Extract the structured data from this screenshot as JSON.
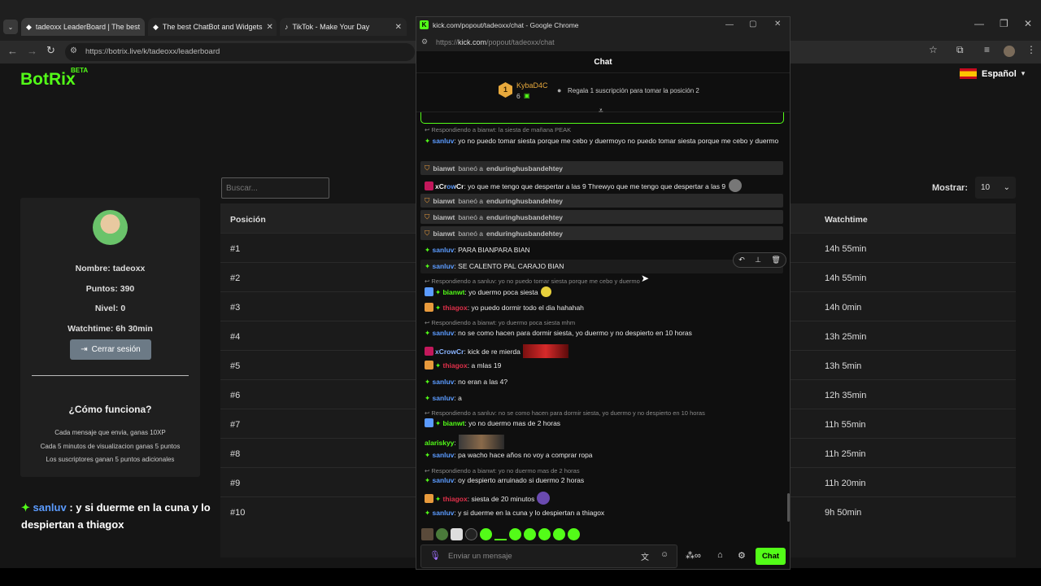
{
  "browser": {
    "tabs": [
      {
        "title": "tadeoxx LeaderBoard | The best"
      },
      {
        "title": "The best ChatBot and Widgets"
      },
      {
        "title": "TikTok - Make Your Day"
      }
    ],
    "url": "https://botrix.live/k/tadeoxx/leaderboard"
  },
  "page": {
    "logo": "BotRix",
    "logo_badge": "BETA",
    "language": "Español",
    "profile": {
      "nombre": "Nombre: tadeoxx",
      "puntos": "Puntos: 390",
      "nivel": "Nivel: 0",
      "watchtime": "Watchtime: 6h 30min",
      "logout": "Cerrar sesión"
    },
    "how": {
      "title": "¿Cómo funciona?",
      "lines": [
        "Cada mensaje que envia, ganas 10XP",
        "Cada 5 minutos de visualizacion ganas 5 puntos",
        "Los suscriptores ganan 5 puntos adicionales"
      ]
    },
    "chat_overlay": {
      "user": "sanluv",
      "text": " : y si duerme en la cuna y lo despiertan a thiagox"
    },
    "search_placeholder": "Buscar...",
    "show_label": "Mostrar:",
    "show_value": "10",
    "table": {
      "col_position": "Posición",
      "col_watchtime": "Watchtime",
      "rows": [
        {
          "pos": "#1",
          "wt": "14h 55min"
        },
        {
          "pos": "#2",
          "wt": "14h 55min"
        },
        {
          "pos": "#3",
          "wt": "14h 0min"
        },
        {
          "pos": "#4",
          "wt": "13h 25min"
        },
        {
          "pos": "#5",
          "wt": "13h 5min"
        },
        {
          "pos": "#6",
          "wt": "12h 35min"
        },
        {
          "pos": "#7",
          "wt": "11h 55min"
        },
        {
          "pos": "#8",
          "wt": "11h 25min"
        },
        {
          "pos": "#9",
          "wt": "11h 20min"
        },
        {
          "pos": "#10",
          "wt": "9h 50min"
        }
      ]
    }
  },
  "popup": {
    "window_title": "kick.com/popout/tadeoxx/chat - Google Chrome",
    "url_prefix": "https://",
    "url_domain": "kick.com",
    "url_path": "/popout/tadeoxx/chat",
    "header": "Chat",
    "pinned": {
      "rank": "1",
      "user": "KybaD4C",
      "count": "6",
      "gift": "Regala 1 suscripción para tomar la posición 2"
    },
    "messages": {
      "r1": "Respondiendo a bianwt: la siesta de mañana PEAK",
      "m1_user": "sanluv",
      "m1_text": ": yo no puedo tomar siesta porque me cebo y duermoyo no puedo tomar siesta porque me cebo y duermo",
      "b1_user": "bianwt",
      "b_mid": "baneó a",
      "b1_target": "enduringhusbandehtey",
      "m2_user": "xCrowCr",
      "m2_text": ": yo que me tengo que despertar a las 9 Threwyo que me tengo que despertar a las 9",
      "m3_user": "sanluv",
      "m3_text": ": PARA BIANPARA BIAN",
      "m4_user": "sanluv",
      "m4_text": ": SE CALENTO PAL CARAJO BIAN",
      "r2": "Respondiendo a sanluv: yo no puedo tomar siesta porque me cebo y duermo",
      "m5_user": "bianwt",
      "m5_text": ": yo duermo poca siesta",
      "m6_user": "thiagox",
      "m6_text": ": yo puedo dormir todo el dia hahahah",
      "r3": "Respondiendo a bianwt: yo duermo poca siesta mhm",
      "m7_user": "sanluv",
      "m7_text": ": no se como hacen para dormir siesta, yo duermo y no despierto en 10 horas",
      "m8_user": "xCrowCr",
      "m8_text": ": kick de re mierda",
      "m9_user": "thiagox",
      "m9_text": ": a mlas 19",
      "m10_user": "sanluv",
      "m10_text": ": no eran a las 4?",
      "m11_user": "sanluv",
      "m11_text": ": a",
      "r4": "Respondiendo a sanluv: no se como hacen para dormir siesta, yo duermo y no despierto en 10 horas",
      "m12_user": "bianwt",
      "m12_text": ": yo no duermo mas de 2 horas",
      "m13_user": "alariskyy",
      "m13_text": ":",
      "m14_user": "sanluv",
      "m14_text": ": pa wacho hace años no voy a comprar ropa",
      "r5": "Respondiendo a bianwt: yo no duermo mas de 2 horas",
      "m15_user": "sanluv",
      "m15_text": ": oy despierto arruinado si duermo 2 horas",
      "m16_user": "thiagox",
      "m16_text": ": siesta de 20 minutos",
      "m17_user": "sanluv",
      "m17_text": ": y si duerme en la cuna y lo despiertan a thiagox"
    },
    "input_placeholder": "Enviar un mensaje",
    "send": "Chat"
  },
  "colors": {
    "green": "#53fc18",
    "blue": "#5b9bff",
    "red": "#e0304a",
    "orange": "#e89a3c"
  }
}
